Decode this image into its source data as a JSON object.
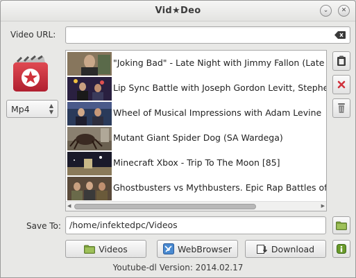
{
  "window": {
    "title": "Vid★Deo",
    "minimize_icon": "chevron-down-icon",
    "close_icon": "close-icon"
  },
  "url_field": {
    "label": "Video URL:",
    "value": "",
    "clear_icon": "backspace-clear-icon"
  },
  "format": {
    "selected": "Mp4"
  },
  "videos": [
    {
      "title": "\"Joking Bad\" - Late Night with Jimmy Fallon (Late Night w",
      "thumb_color": "#5b4a3a"
    },
    {
      "title": "Lip Sync Battle with Joseph Gordon Levitt, Stephen Merc",
      "thumb_color": "#3a2f4a"
    },
    {
      "title": "Wheel of Musical Impressions with Adam Levine",
      "thumb_color": "#2f3a5a"
    },
    {
      "title": "Mutant Giant Spider Dog (SA Wardega)",
      "thumb_color": "#6a6058"
    },
    {
      "title": "Minecraft Xbox - Trip To The Moon [85]",
      "thumb_color": "#2a2a3a"
    },
    {
      "title": "Ghostbusters vs Mythbusters.  Epic Rap Battles of History",
      "thumb_color": "#4a3a2a"
    }
  ],
  "side_buttons": {
    "paste_icon": "clipboard-icon",
    "remove_icon": "red-x-icon",
    "clear_icon": "trash-icon"
  },
  "save_to": {
    "label": "Save To:",
    "value": "/home/infektedpc/Videos",
    "browse_icon": "folder-icon"
  },
  "actions": {
    "videos_label": "Videos",
    "webbrowser_label": "WebBrowser",
    "download_label": "Download",
    "info_icon": "info-icon"
  },
  "footer": {
    "text": "Youtube-dl Version: 2014.02.17"
  },
  "colors": {
    "accent_red": "#d0323c",
    "folder_green": "#7a9e3a",
    "info_green": "#6a9a2a"
  }
}
